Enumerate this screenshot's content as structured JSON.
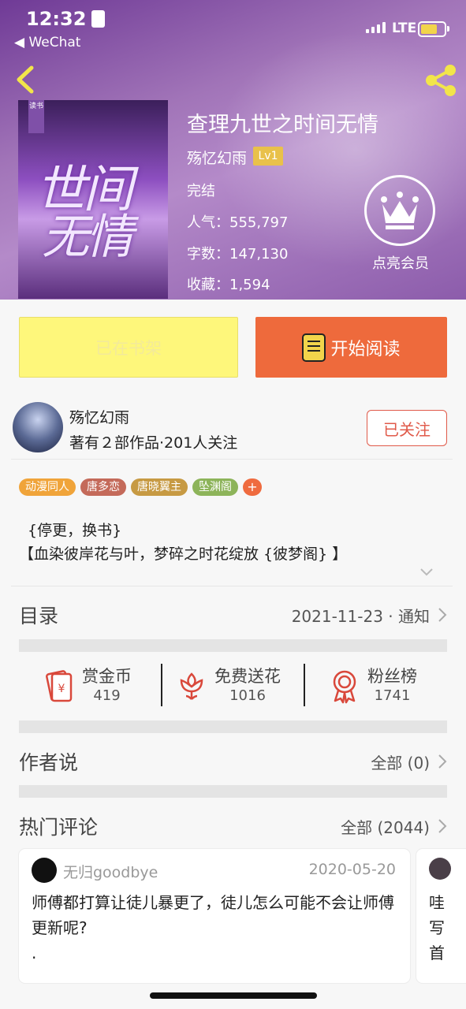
{
  "status_bar": {
    "time": "12:32",
    "back_app": "◀ WeChat",
    "network": "LTE"
  },
  "book": {
    "title": "查理九世之时间无情",
    "author": "殇忆幻雨",
    "level": "Lv1",
    "status": "完结",
    "popularity": "人气：555,797",
    "word_count": "字数：147,130",
    "favorites": "收藏：1,594",
    "vip_label": "点亮会员",
    "cover_text_1": "世间",
    "cover_text_2": "无情",
    "cover_tag": "读书"
  },
  "actions": {
    "shelf_label": "已在书架",
    "read_label": "开始阅读"
  },
  "author_card": {
    "name": "殇忆幻雨",
    "info": "著有２部作品·201人关注",
    "follow_label": "已关注"
  },
  "tags": [
    {
      "label": "动漫同人",
      "color": "#f0a43a"
    },
    {
      "label": "唐多恋",
      "color": "#c46a5a"
    },
    {
      "label": "唐晓翼主",
      "color": "#c79a43"
    },
    {
      "label": "坠渊阁",
      "color": "#8db45a"
    }
  ],
  "tags_more": "+",
  "description": {
    "line1": "{停更，换书}",
    "line2": "【血染彼岸花与叶，梦碎之时花绽放 {彼梦阁} 】"
  },
  "catalog": {
    "label": "目录",
    "value": "2021-11-23 · 通知"
  },
  "stats": [
    {
      "label": "赏金币",
      "count": "419",
      "icon": "red-envelope-icon"
    },
    {
      "label": "免费送花",
      "count": "1016",
      "icon": "flower-icon"
    },
    {
      "label": "粉丝榜",
      "count": "1741",
      "icon": "medal-icon"
    }
  ],
  "author_says": {
    "label": "作者说",
    "value": "全部 (0)"
  },
  "hot_comments": {
    "label": "热门评论",
    "value": "全部 (2044)"
  },
  "comments": [
    {
      "user": "无归goodbye",
      "date": "2020-05-20",
      "text": "师傅都打算让徒儿暴更了，徒儿怎么可能不会让师傅更新呢?",
      "extra": "."
    },
    {
      "text_lines": [
        "哇",
        "写",
        "首"
      ]
    }
  ]
}
